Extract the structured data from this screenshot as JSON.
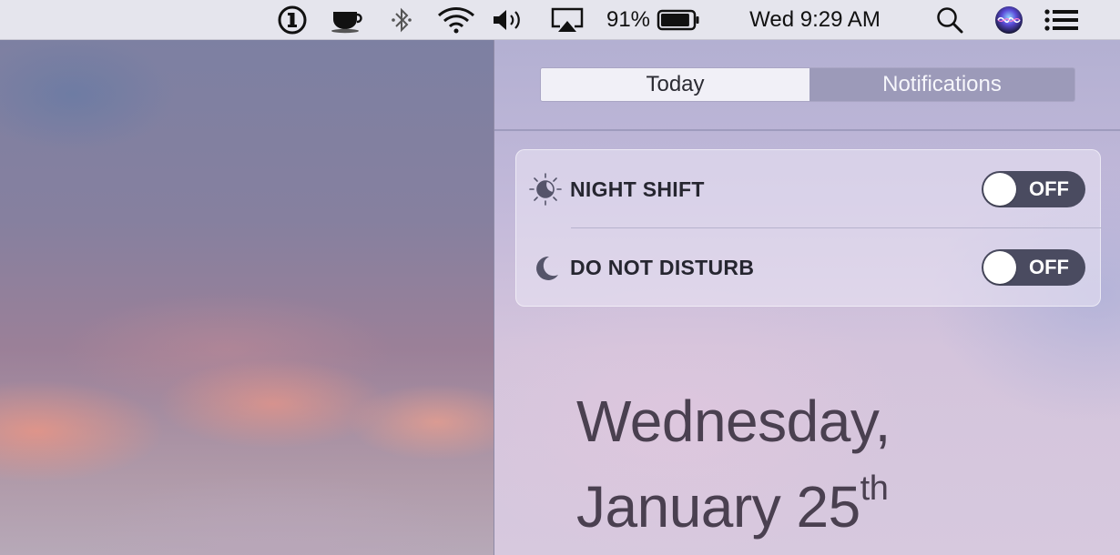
{
  "menubar": {
    "icons": [
      "1password-icon",
      "coffee-cup-icon",
      "bluetooth-icon",
      "wifi-icon",
      "volume-icon",
      "airplay-icon",
      "battery-icon",
      "spotlight-search-icon",
      "siri-icon",
      "notification-center-icon"
    ],
    "battery_percent": "91%",
    "battery_level": 0.91,
    "clock": "Wed 9:29 AM"
  },
  "notification_center": {
    "tabs": [
      {
        "label": "Today",
        "selected": true
      },
      {
        "label": "Notifications",
        "selected": false
      }
    ],
    "toggles": [
      {
        "icon": "night-shift-icon",
        "label": "NIGHT SHIFT",
        "state": "OFF"
      },
      {
        "icon": "moon-icon",
        "label": "DO NOT DISTURB",
        "state": "OFF"
      }
    ],
    "date": {
      "weekday": "Wednesday,",
      "month_day": "January 25",
      "ordinal_suffix": "th"
    }
  },
  "colors": {
    "switch_off": "#4a4b60",
    "selected_tab": "#f1f0f7",
    "unselected_tab": "#9c9ab9"
  }
}
